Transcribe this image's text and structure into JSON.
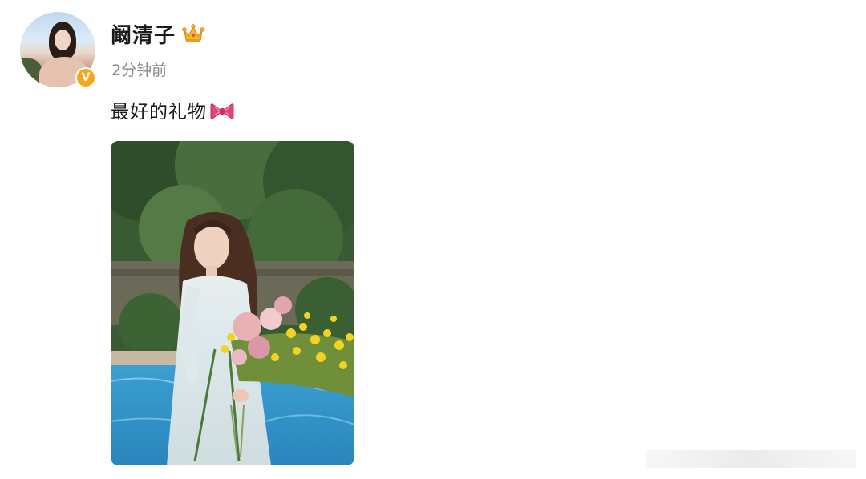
{
  "post": {
    "author": {
      "name": "阚清子",
      "verified_badge": "V",
      "badge_icon": "crown-icon",
      "accent_color": "#f7a51a"
    },
    "timestamp": "2分钟前",
    "text": "最好的礼物",
    "emoji": "ribbon-bow-icon",
    "image": {
      "description_icon": "photo-woman-with-flowers"
    }
  }
}
